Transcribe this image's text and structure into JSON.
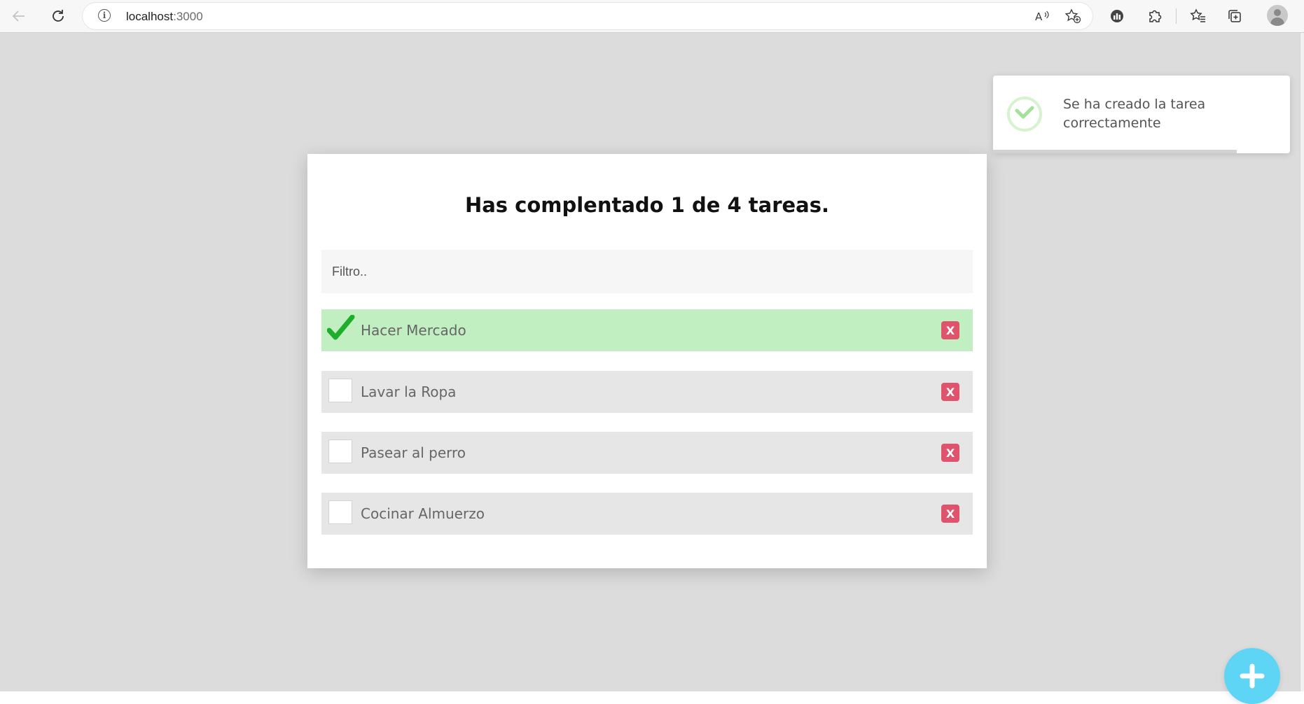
{
  "browser": {
    "url_host": "localhost",
    "url_port": ":3000",
    "back_icon": "arrow-left-icon",
    "reload_icon": "reload-icon",
    "info_icon": "info-icon",
    "read_aloud_icon": "read-aloud-icon",
    "add_favorite_icon": "star-add-icon",
    "extensions": [
      "performance-icon",
      "puzzle-icon",
      "favorites-icon",
      "collections-icon",
      "profile-icon"
    ]
  },
  "app": {
    "title": "Has complentado 1 de 4 tareas.",
    "completed": 1,
    "total": 4,
    "filter": {
      "placeholder": "Filtro..",
      "value": ""
    },
    "todos": [
      {
        "label": "Hacer Mercado",
        "done": true,
        "delete_label": "X"
      },
      {
        "label": "Lavar la Ropa",
        "done": false,
        "delete_label": "X"
      },
      {
        "label": "Pasear al perro",
        "done": false,
        "delete_label": "X"
      },
      {
        "label": "Cocinar Almuerzo",
        "done": false,
        "delete_label": "X"
      }
    ],
    "add_button_icon": "plus-icon"
  },
  "toast": {
    "message": "Se ha creado la tarea correctamente",
    "icon": "check-circle-icon",
    "progress": 0.82
  },
  "colors": {
    "page_background": "#dcdcdc",
    "done_row": "#c1efc1",
    "pending_row": "#e6e6e6",
    "delete_button": "#e0536d",
    "check_green": "#1fae2c",
    "fab": "#5fd5f5"
  }
}
